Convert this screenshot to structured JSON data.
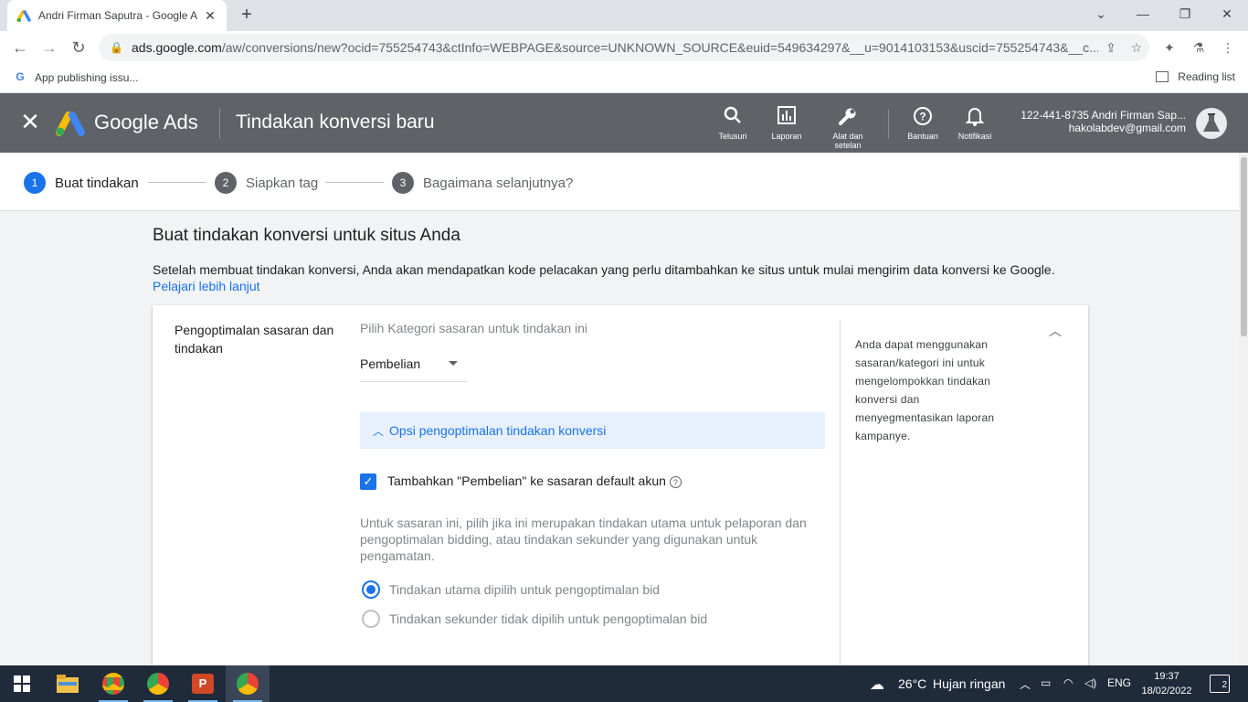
{
  "browser": {
    "tab_title": "Andri Firman Saputra - Google A",
    "url_host": "ads.google.com",
    "url_path": "/aw/conversions/new?ocid=755254743&ctInfo=WEBPAGE&source=UNKNOWN_SOURCE&euid=549634297&__u=9014103153&uscid=755254743&__c...",
    "bookmark": "App publishing issu...",
    "reading_list": "Reading list"
  },
  "header": {
    "brand": "Google Ads",
    "page_title": "Tindakan konversi baru",
    "buttons": [
      {
        "label": "Telusuri",
        "icon": "search-icon"
      },
      {
        "label": "Laporan",
        "icon": "bar-chart-icon"
      },
      {
        "label": "Alat dan setelan",
        "icon": "wrench-icon"
      },
      {
        "label": "Bantuan",
        "icon": "help-icon"
      },
      {
        "label": "Notifikasi",
        "icon": "bell-icon"
      }
    ],
    "account_id": "122-441-8735 Andri Firman Sap...",
    "account_email": "hakolabdev@gmail.com"
  },
  "stepper": {
    "steps": [
      {
        "num": "1",
        "label": "Buat tindakan"
      },
      {
        "num": "2",
        "label": "Siapkan tag"
      },
      {
        "num": "3",
        "label": "Bagaimana selanjutnya?"
      }
    ]
  },
  "main": {
    "section_title": "Buat tindakan konversi untuk situs Anda",
    "description": "Setelah membuat tindakan konversi, Anda akan mendapatkan kode pelacakan yang perlu ditambahkan ke situs untuk mulai mengirim data konversi ke Google.",
    "learn_more": "Pelajari lebih lanjut"
  },
  "card": {
    "label": "Pengoptimalan sasaran dan tindakan",
    "hint": "Pilih Kategori sasaran untuk tindakan ini",
    "dropdown_value": "Pembelian",
    "options_toggle": "Opsi pengoptimalan tindakan konversi",
    "checkbox_label": "Tambahkan \"Pembelian\" ke sasaran default akun",
    "checkbox_checked": true,
    "sub_description": "Untuk sasaran ini, pilih jika ini merupakan tindakan utama untuk pelaporan dan pengoptimalan bidding, atau tindakan sekunder yang digunakan untuk pengamatan.",
    "radio_primary": "Tindakan utama dipilih untuk pengoptimalan bid",
    "radio_secondary": "Tindakan sekunder tidak dipilih untuk pengoptimalan bid",
    "side_help": "Anda dapat menggunakan sasaran/kategori ini untuk mengelompokkan tindakan konversi dan menyegmentasikan laporan kampanye."
  },
  "taskbar": {
    "weather_temp": "26°C",
    "weather_desc": "Hujan ringan",
    "lang": "ENG",
    "time": "19:37",
    "date": "18/02/2022",
    "notif_count": "2"
  },
  "colors": {
    "header_bg": "#5f6368",
    "accent": "#1a73e8",
    "options_bg": "#e8f0fe"
  }
}
